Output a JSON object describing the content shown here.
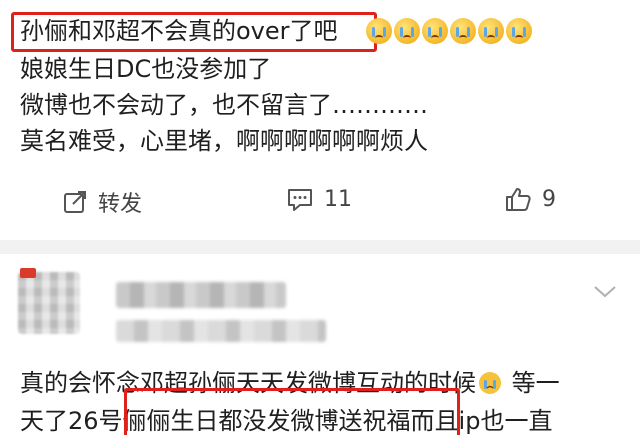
{
  "post": {
    "line1": "孙俪和邓超不会真的over了吧",
    "line2": "娘娘生日DC也没参加了",
    "line3": "微博也不会动了，也不留言了…………",
    "line4": "莫名难受，心里堵，啊啊啊啊啊啊烦人",
    "emojis": [
      "crying-emoji",
      "crying-emoji",
      "crying-emoji",
      "crying-emoji",
      "crying-emoji",
      "crying-emoji"
    ]
  },
  "actions": {
    "repost_label": "转发",
    "comment_count": "11",
    "like_count": "9"
  },
  "comment": {
    "line1_a": "真的会怀念邓超孙俪天天发微博互动的时候",
    "line1_b": "等一",
    "line2_a": "天了26号",
    "line2_highlight": "俪俪生日都没发微博送祝福",
    "line2_b": "而且ip也一直"
  },
  "colors": {
    "highlight_box": "#e0201b",
    "divider": "#f2f2f2",
    "text": "#1f1f1f",
    "icon": "#444444"
  }
}
